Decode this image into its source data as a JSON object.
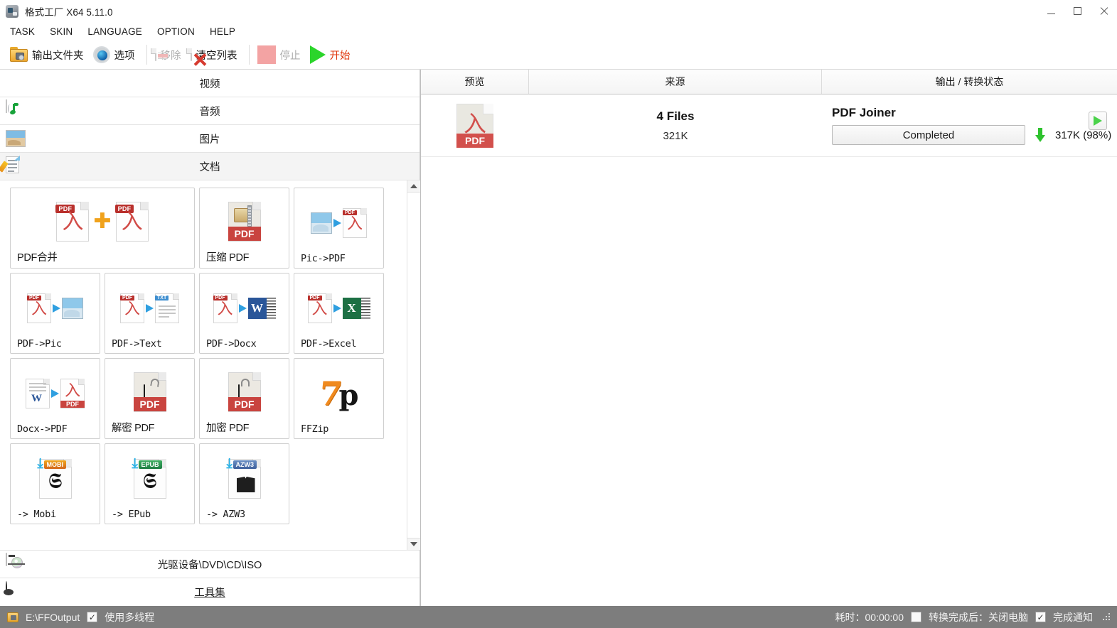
{
  "window": {
    "title": "格式工厂 X64 5.11.0",
    "icon": "app-icon",
    "controls": {
      "minimize": "–",
      "maximize": "□",
      "close": "✕"
    }
  },
  "menubar": {
    "items": [
      {
        "label": "TASK"
      },
      {
        "label": "SKIN"
      },
      {
        "label": "LANGUAGE"
      },
      {
        "label": "OPTION"
      },
      {
        "label": "HELP"
      }
    ]
  },
  "toolbar": {
    "output_folder": "输出文件夹",
    "options": "选项",
    "remove": "移除",
    "clear_list": "清空列表",
    "stop": "停止",
    "start": "开始"
  },
  "sidebar": {
    "categories": [
      {
        "label": "视频",
        "icon": "film-icon",
        "selected": false
      },
      {
        "label": "音频",
        "icon": "music-note-icon",
        "selected": false
      },
      {
        "label": "图片",
        "icon": "photo-icon",
        "selected": false
      },
      {
        "label": "文档",
        "icon": "document-pencil-icon",
        "selected": true
      }
    ],
    "bottom_items": [
      {
        "label": "光驱设备\\DVD\\CD\\ISO",
        "icon": "disc-drive-icon",
        "link": false
      },
      {
        "label": "工具集",
        "icon": "film-reel-icon",
        "link": true
      }
    ]
  },
  "format_grid": {
    "tiles": [
      {
        "label": "PDF合并",
        "art": "pdf-merge",
        "wide": true,
        "cjk": true
      },
      {
        "label": "压缩 PDF",
        "art": "pdf-compress",
        "wide": false,
        "cjk": true
      },
      {
        "label": "Pic->PDF",
        "art": "pic-to-pdf",
        "wide": false,
        "cjk": false
      },
      {
        "label": "PDF->Pic",
        "art": "pdf-to-pic",
        "wide": false,
        "cjk": false
      },
      {
        "label": "PDF->Text",
        "art": "pdf-to-text",
        "wide": false,
        "cjk": false
      },
      {
        "label": "PDF->Docx",
        "art": "pdf-to-docx",
        "wide": false,
        "cjk": false
      },
      {
        "label": "PDF->Excel",
        "art": "pdf-to-excel",
        "wide": false,
        "cjk": false
      },
      {
        "label": "Docx->PDF",
        "art": "docx-to-pdf",
        "wide": false,
        "cjk": false
      },
      {
        "label": "解密 PDF",
        "art": "pdf-decrypt",
        "wide": false,
        "cjk": true
      },
      {
        "label": "加密 PDF",
        "art": "pdf-encrypt",
        "wide": false,
        "cjk": true
      },
      {
        "label": "FFZip",
        "art": "ffzip",
        "wide": false,
        "cjk": false
      },
      {
        "label": "-> Mobi",
        "art": "to-mobi",
        "wide": false,
        "cjk": false
      },
      {
        "label": "-> EPub",
        "art": "to-epub",
        "wide": false,
        "cjk": false
      },
      {
        "label": "-> AZW3",
        "art": "to-azw3",
        "wide": false,
        "cjk": false
      }
    ],
    "badges": {
      "mobi": "MOBI",
      "epub": "EPUB",
      "azw3": "AZW3",
      "pdf": "PDF",
      "txt": "TXT",
      "word": "W",
      "excel": "X",
      "sevenzip_7": "7",
      "sevenzip_zip": "p"
    }
  },
  "task_list": {
    "columns": [
      {
        "label": "预览"
      },
      {
        "label": "来源"
      },
      {
        "label": "输出 / 转换状态"
      }
    ],
    "rows": [
      {
        "preview_icon": "pdf-file-icon",
        "preview_badge": "PDF",
        "source_title": "4 Files",
        "source_size": "321K",
        "output_title": "PDF Joiner",
        "status": "Completed",
        "output_size": "317K  (98%)",
        "play_label": "play-icon"
      }
    ]
  },
  "statusbar": {
    "output_path": "E:\\FFOutput",
    "multithread_label": "使用多线程",
    "multithread_checked": true,
    "elapsed": "耗时：00:00:00",
    "shutdown_label": "转换完成后：关闭电脑",
    "shutdown_checked": false,
    "notify_label": "完成通知",
    "notify_checked": true
  },
  "colors": {
    "accent_red": "#e03a10",
    "green": "#2ec22e",
    "pdf_red": "#c9443f",
    "statusbar_bg": "#7d7d7d"
  }
}
